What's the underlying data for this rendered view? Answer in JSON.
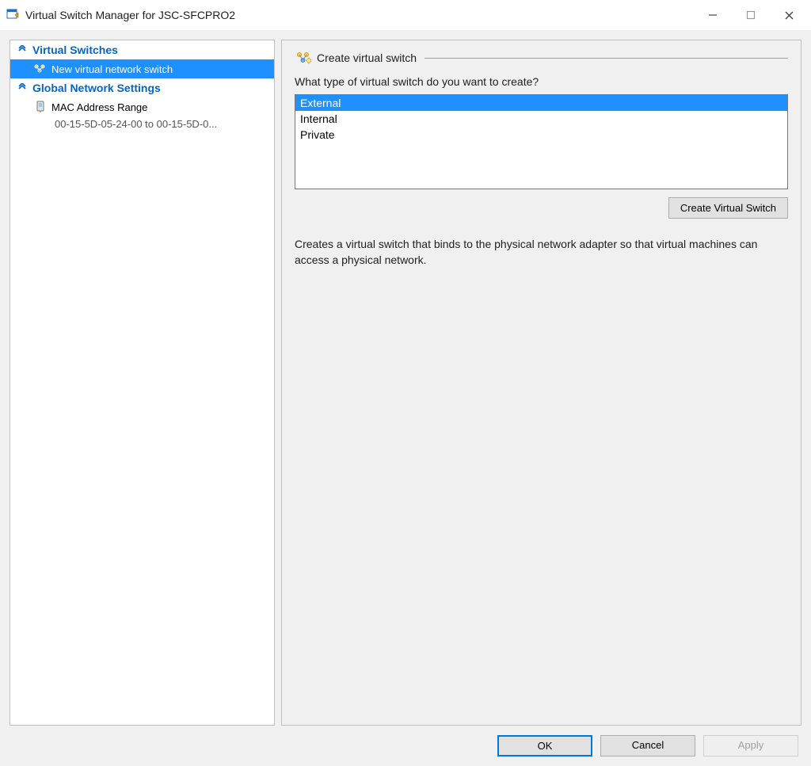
{
  "titlebar": {
    "title": "Virtual Switch Manager for JSC-SFCPRO2"
  },
  "tree": {
    "section1": {
      "label": "Virtual Switches",
      "item_new": "New virtual network switch"
    },
    "section2": {
      "label": "Global Network Settings",
      "item_mac": "MAC Address Range",
      "mac_detail": "00-15-5D-05-24-00 to 00-15-5D-0..."
    }
  },
  "main": {
    "section_title": "Create virtual switch",
    "prompt": "What type of virtual switch do you want to create?",
    "options": {
      "external": "External",
      "internal": "Internal",
      "private": "Private"
    },
    "create_button": "Create Virtual Switch",
    "description": "Creates a virtual switch that binds to the physical network adapter so that virtual machines can access a physical network."
  },
  "footer": {
    "ok": "OK",
    "cancel": "Cancel",
    "apply": "Apply"
  }
}
